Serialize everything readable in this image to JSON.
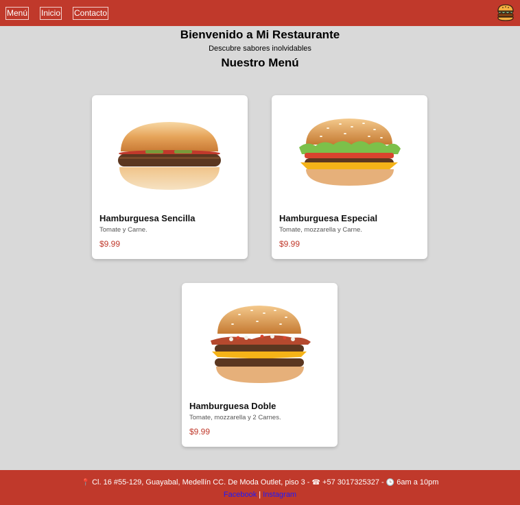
{
  "nav": {
    "items": [
      "Menú",
      "Inicio",
      "Contacto"
    ],
    "logo_icon": "burger-icon"
  },
  "hero": {
    "title": "Bienvenido a Mi Restaurante",
    "tagline": "Descubre sabores inolvidables",
    "menu_heading": "Nuestro Menú"
  },
  "menu": {
    "items": [
      {
        "name": "Hamburguesa Sencilla",
        "description": "Tomate y Carne.",
        "price": "$9.99",
        "image": "single-burger-image"
      },
      {
        "name": "Hamburguesa Especial",
        "description": "Tomate, mozzarella y Carne.",
        "price": "$9.99",
        "image": "special-burger-image"
      },
      {
        "name": "Hamburguesa Doble",
        "description": "Tomate, mozzarella y 2 Carnes.",
        "price": "$9.99",
        "image": "double-burger-image"
      }
    ]
  },
  "footer": {
    "address": "Cl. 16 #55-129, Guayabal, Medellín CC. De Moda Outlet, piso 3 -",
    "phone": "+57 3017325327 -",
    "hours": "6am a 10pm",
    "separator": "|",
    "social": [
      "Facebook",
      "Instagram"
    ],
    "icons": [
      "pin-icon",
      "phone-icon",
      "clock-icon"
    ]
  },
  "colors": {
    "brand": "#c0392b",
    "background": "#d9d9d9",
    "price": "#c0392b",
    "link": "#1a1aff"
  }
}
